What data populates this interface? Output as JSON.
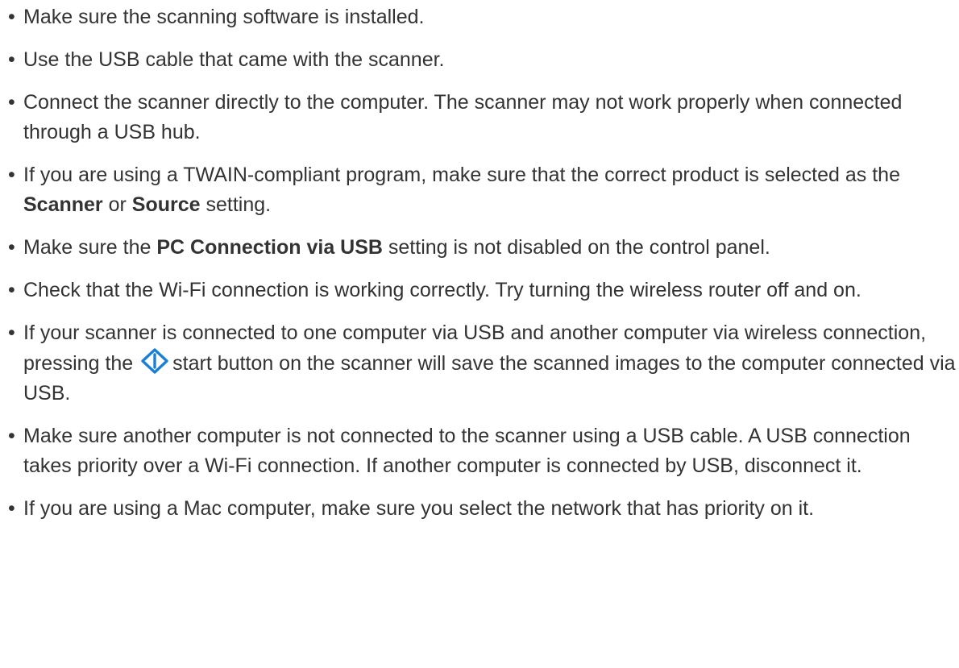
{
  "tips": [
    {
      "text": "Make sure the scanning software is installed."
    },
    {
      "text": "Use the USB cable that came with the scanner."
    },
    {
      "text": "Connect the scanner directly to the computer. The scanner may not work properly when connected through a USB hub."
    },
    {
      "pre": "If you are using a TWAIN-compliant program, make sure that the correct product is selected as the ",
      "bold1": "Scanner",
      "mid": " or ",
      "bold2": "Source",
      "post": " setting."
    },
    {
      "pre": "Make sure the ",
      "bold": "PC Connection via USB",
      "post": " setting is not disabled on the control panel."
    },
    {
      "text": "Check that the Wi-Fi connection is working correctly. Try turning the wireless router off and on."
    },
    {
      "pre": "If your scanner is connected to one computer via USB and another computer via wireless connection, pressing the",
      "icon": "start-button-icon",
      "post": "start button on the scanner will save the scanned images to the computer connected via USB."
    },
    {
      "text": "Make sure another computer is not connected to the scanner using a USB cable. A USB connection takes priority over a Wi-Fi connection. If another computer is connected by USB, disconnect it."
    },
    {
      "text": "If you are using a Mac computer, make sure you select the network that has priority on it."
    }
  ],
  "colors": {
    "text": "#333333",
    "icon": "#1a7fd4"
  }
}
